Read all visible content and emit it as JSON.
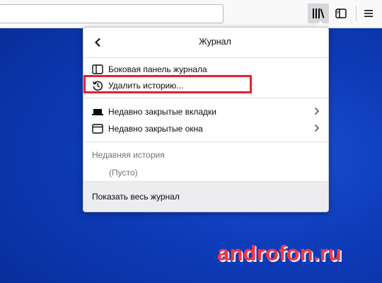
{
  "toolbar": {
    "url_value": "",
    "icons": [
      "library-icon",
      "sidebar-icon",
      "hamburger-menu-icon"
    ]
  },
  "panel": {
    "title": "Журнал",
    "items": [
      {
        "label": "Боковая панель журнала",
        "icon": "sidebar-history-icon"
      },
      {
        "label": "Удалить историю...",
        "icon": "clear-history-icon"
      },
      {
        "label": "Недавно закрытые вкладки",
        "icon": "tab-icon"
      },
      {
        "label": "Недавно закрытые окна",
        "icon": "window-icon"
      }
    ],
    "recent_history_label": "Недавняя история",
    "empty_label": "(Пусто)",
    "footer_label": "Показать весь журнал"
  },
  "colors": {
    "desktop": "#0d3bb8",
    "highlight": "#e8202d",
    "watermark": "#ff3240"
  },
  "watermark": "androfon.ru"
}
